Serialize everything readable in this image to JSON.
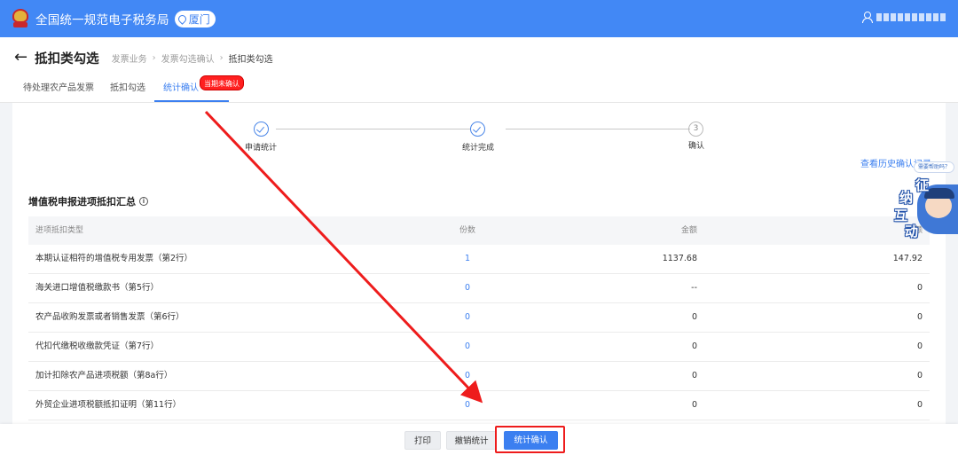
{
  "topbar": {
    "app_title": "全国统一规范电子税务局",
    "region": "厦门",
    "user_name": "",
    "icons": [
      "emblem-logo",
      "location-pin-icon",
      "user-icon"
    ]
  },
  "header": {
    "title": "抵扣类勾选",
    "breadcrumb": [
      "发票业务",
      "发票勾选确认",
      "抵扣类勾选"
    ]
  },
  "tabs": [
    {
      "label": "待处理农产品发票",
      "active": false
    },
    {
      "label": "抵扣勾选",
      "active": false
    },
    {
      "label": "统计确认",
      "active": true
    }
  ],
  "tab_badge": "当期未确认",
  "steps": [
    {
      "label": "申请统计",
      "status": "done"
    },
    {
      "label": "统计完成",
      "status": "done"
    },
    {
      "label": "确认",
      "status": "pending",
      "number": "3"
    }
  ],
  "history_link": "查看历史确认记录",
  "section_title": "增值税申报进项抵扣汇总",
  "table": {
    "headers": [
      "进项抵扣类型",
      "份数",
      "金额",
      "税额"
    ],
    "rows": [
      {
        "type": "本期认证相符的增值税专用发票（第2行）",
        "count": "1",
        "amount": "1137.68",
        "tax": "147.92"
      },
      {
        "type": "海关进口增值税缴款书（第5行）",
        "count": "0",
        "amount": "--",
        "tax": "0"
      },
      {
        "type": "农产品收购发票或者销售发票（第6行）",
        "count": "0",
        "amount": "0",
        "tax": "0"
      },
      {
        "type": "代扣代缴税收缴款凭证（第7行）",
        "count": "0",
        "amount": "0",
        "tax": "0"
      },
      {
        "type": "加计扣除农产品进项税额（第8a行）",
        "count": "0",
        "amount": "0",
        "tax": "0"
      },
      {
        "type": "外贸企业进项税额抵扣证明（第11行）",
        "count": "0",
        "amount": "0",
        "tax": "0"
      }
    ]
  },
  "footer": {
    "print": "打印",
    "cancel_stats": "撤销统计",
    "confirm_stats": "统计确认"
  },
  "assistant": {
    "bubble": "需要帮助吗？",
    "glyphs": [
      "征",
      "纳",
      "互",
      "动"
    ]
  },
  "colors": {
    "brand_blue": "#4288f5",
    "link_blue": "#3b7ff0",
    "annotation_red": "#ee1c1c"
  }
}
